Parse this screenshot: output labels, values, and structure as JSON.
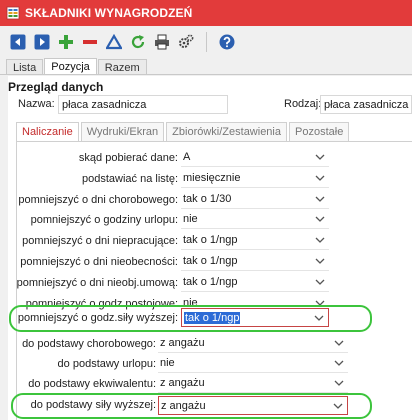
{
  "window": {
    "title": "SKŁADNIKI WYNAGRODZEŃ"
  },
  "tabs_top": [
    {
      "label": "Lista",
      "active": false
    },
    {
      "label": "Pozycja",
      "active": true
    },
    {
      "label": "Razem",
      "active": false
    }
  ],
  "section": {
    "title": "Przegląd danych"
  },
  "fields": {
    "nazwa_label": "Nazwa:",
    "nazwa_value": "płaca zasadnicza",
    "rodzaj_label": "Rodzaj:",
    "rodzaj_value": "płaca zasadnicza"
  },
  "tabs_mid": [
    {
      "label": "Naliczanie",
      "active": true
    },
    {
      "label": "Wydruki/Ekran",
      "active": false
    },
    {
      "label": "Zbiorówki/Zestawienia",
      "active": false
    },
    {
      "label": "Pozostałe",
      "active": false
    }
  ],
  "rows_a": [
    {
      "label": "skąd pobierać dane:",
      "value": "A"
    },
    {
      "label": "podstawiać na listę:",
      "value": "miesięcznie"
    },
    {
      "label": "pomniejszyć o dni chorobowego:",
      "value": "tak o 1/30"
    },
    {
      "label": "pomniejszyć o godziny urlopu:",
      "value": "nie"
    },
    {
      "label": "pomniejszyć o dni niepracujące:",
      "value": "tak o 1/ngp"
    },
    {
      "label": "pomniejszyć o dni nieobecności:",
      "value": "tak o 1/ngp"
    },
    {
      "label": "pomniejszyć o dni nieobj.umową:",
      "value": "tak o 1/ngp"
    },
    {
      "label": "pomniejszyć o godz.postojowe:",
      "value": "nie"
    }
  ],
  "row_highlight_a": {
    "label": "pomniejszyć o godz.siły wyższej:",
    "value": "tak o 1/ngp"
  },
  "rows_b": [
    {
      "label": "do podstawy chorobowego:",
      "value": "z angażu"
    },
    {
      "label": "do podstawy urlopu:",
      "value": "nie"
    },
    {
      "label": "do podstawy ekwiwalentu:",
      "value": "z angażu"
    }
  ],
  "row_highlight_b": {
    "label": "do podstawy siły wyższej:",
    "value": "z angażu"
  },
  "colors": {
    "title_bar": "#e23b3b",
    "highlight": "#3cc43c",
    "selection": "#2c6bd6"
  }
}
